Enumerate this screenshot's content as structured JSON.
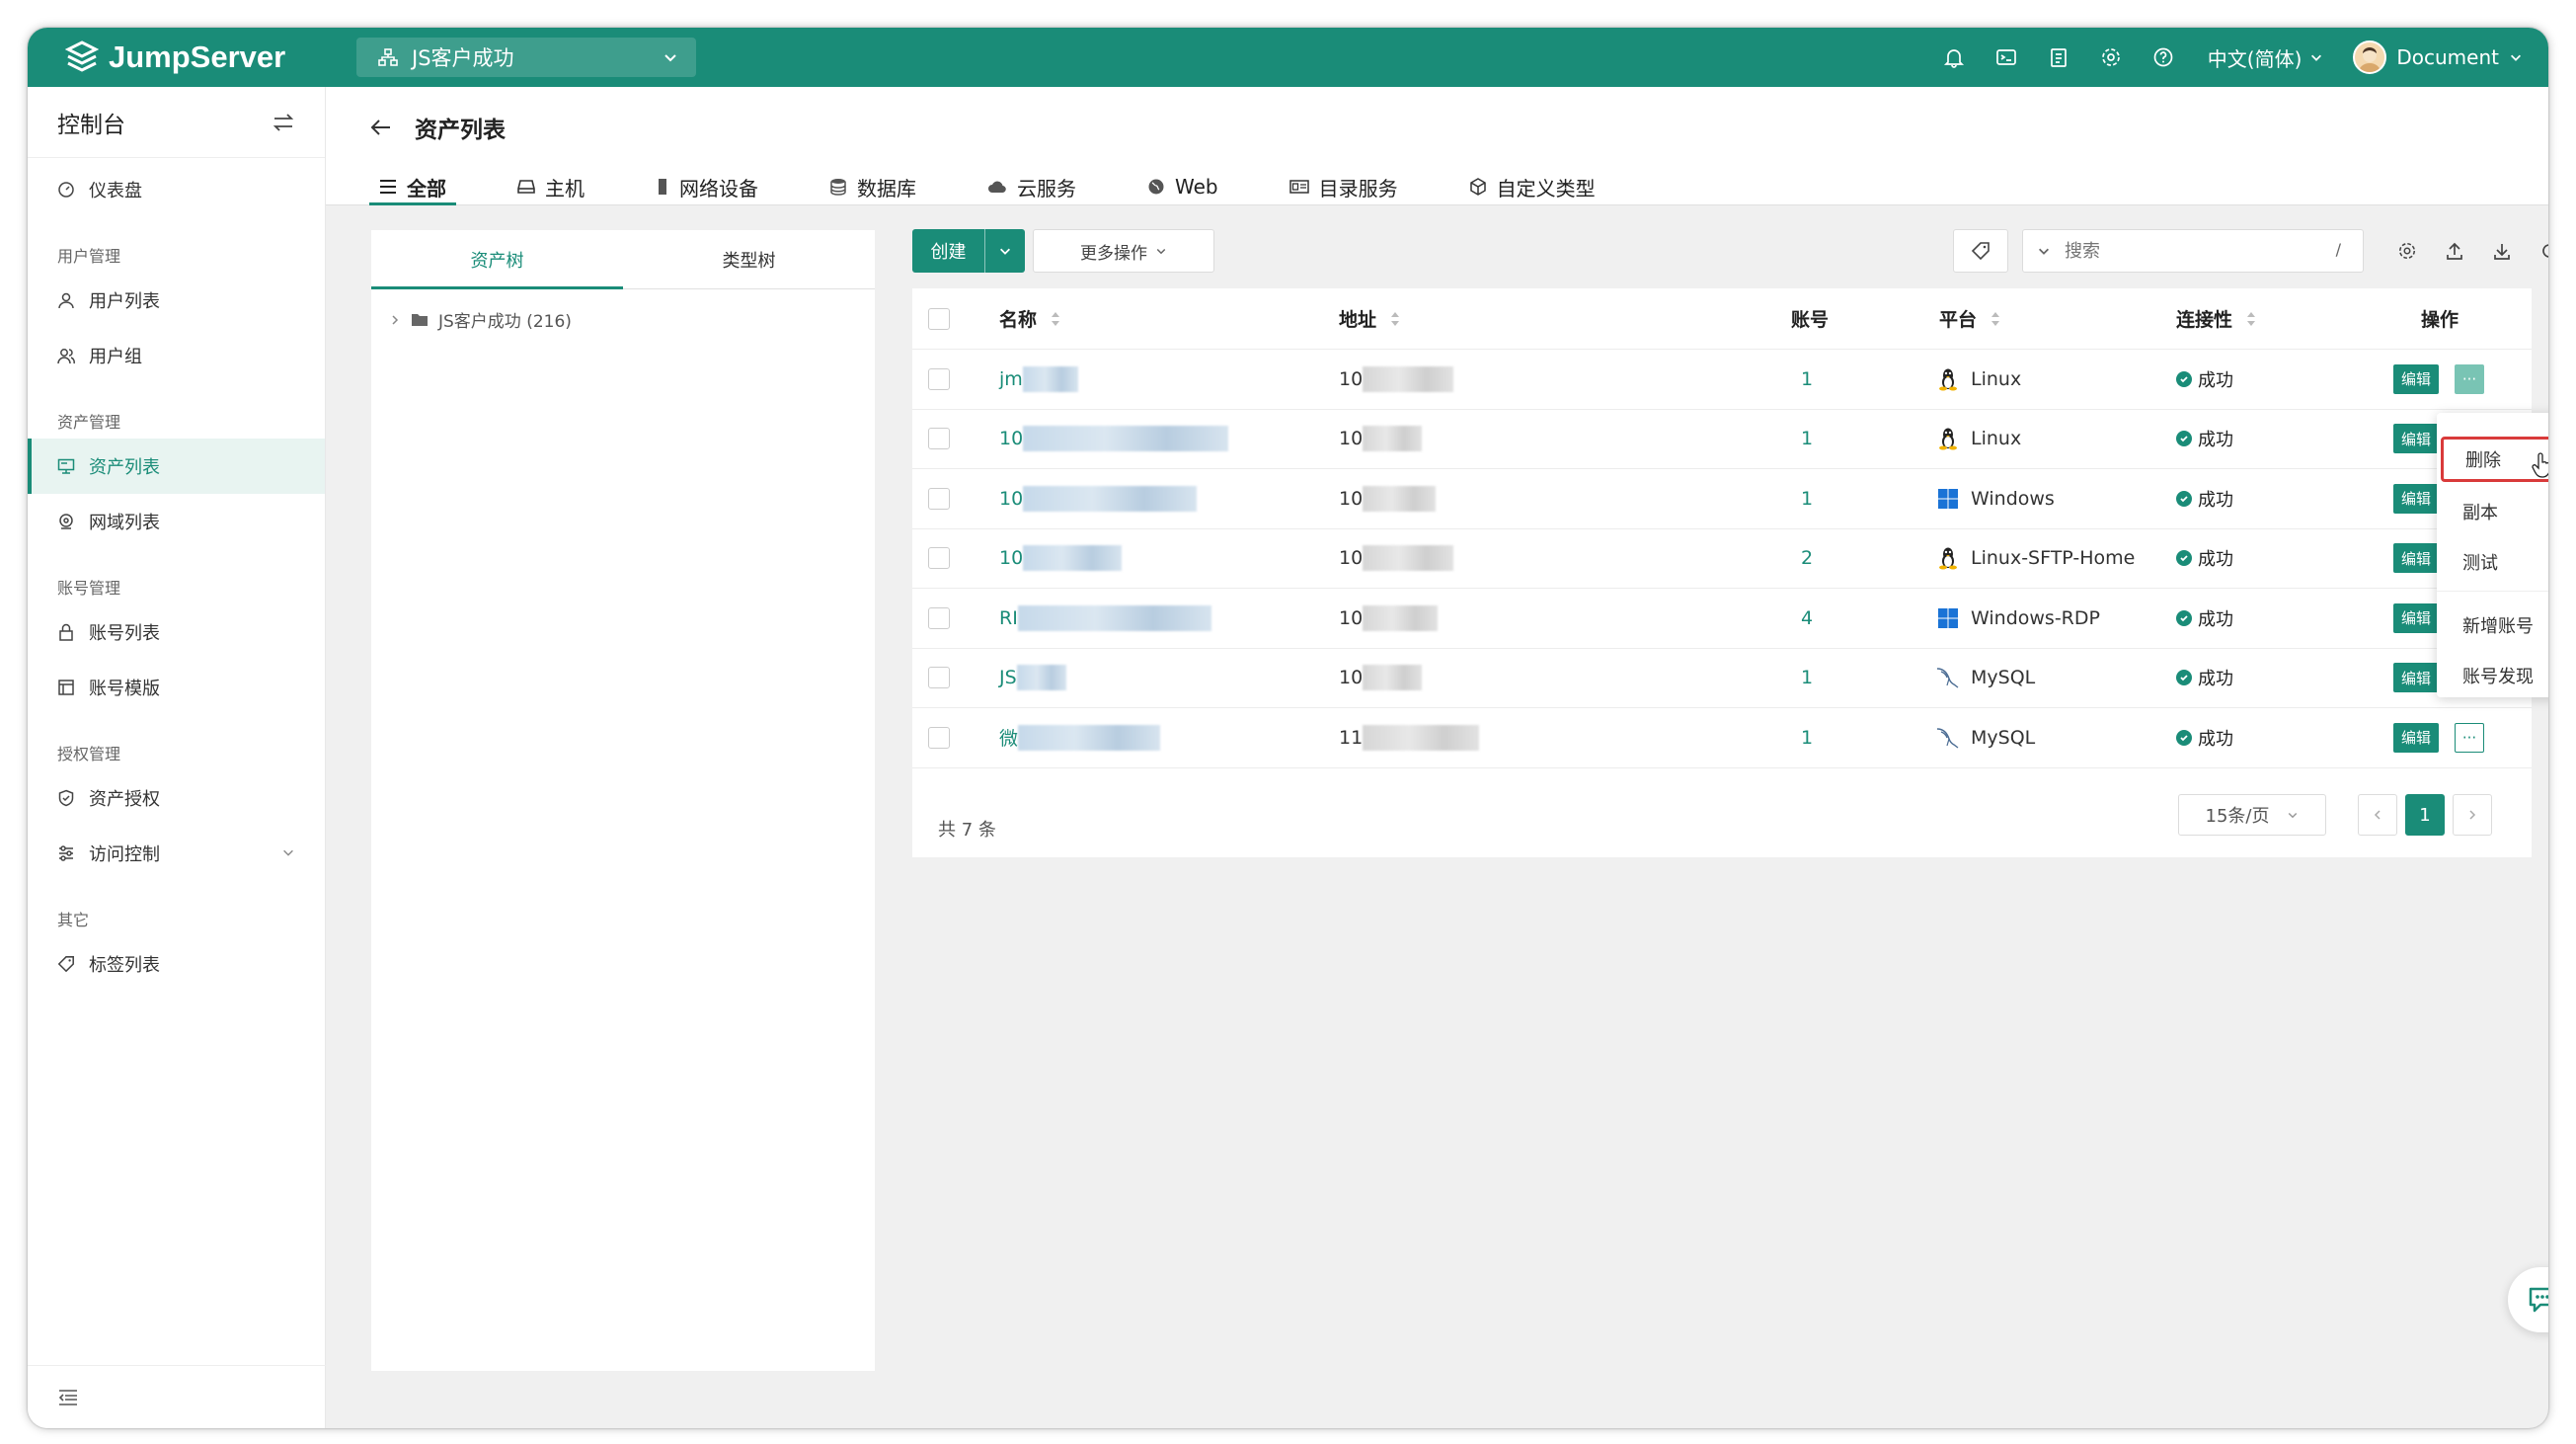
{
  "topbar": {
    "brand": "JumpServer",
    "org": "JS客户成功",
    "language": "中文(简体)",
    "user": "Document",
    "icons": [
      "bell-icon",
      "terminal-icon",
      "clipboard-icon",
      "gear-icon",
      "help-icon"
    ]
  },
  "sidebar": {
    "title": "控制台",
    "items": [
      {
        "type": "item",
        "label": "仪表盘",
        "icon": "dashboard-icon"
      },
      {
        "type": "group",
        "label": "用户管理"
      },
      {
        "type": "item",
        "label": "用户列表",
        "icon": "user-icon"
      },
      {
        "type": "item",
        "label": "用户组",
        "icon": "user-group-icon"
      },
      {
        "type": "group",
        "label": "资产管理"
      },
      {
        "type": "item",
        "label": "资产列表",
        "icon": "monitor-icon",
        "active": true
      },
      {
        "type": "item",
        "label": "网域列表",
        "icon": "location-icon"
      },
      {
        "type": "group",
        "label": "账号管理"
      },
      {
        "type": "item",
        "label": "账号列表",
        "icon": "lock-icon"
      },
      {
        "type": "item",
        "label": "账号模版",
        "icon": "template-icon"
      },
      {
        "type": "group",
        "label": "授权管理"
      },
      {
        "type": "item",
        "label": "资产授权",
        "icon": "shield-icon"
      },
      {
        "type": "item",
        "label": "访问控制",
        "icon": "access-control-icon",
        "expandable": true
      },
      {
        "type": "group",
        "label": "其它"
      },
      {
        "type": "item",
        "label": "标签列表",
        "icon": "tag-icon"
      }
    ]
  },
  "page": {
    "title": "资产列表",
    "tabs": [
      {
        "label": "全部",
        "icon": "list-icon",
        "active": true
      },
      {
        "label": "主机",
        "icon": "host-icon"
      },
      {
        "label": "网络设备",
        "icon": "network-device-icon"
      },
      {
        "label": "数据库",
        "icon": "database-icon"
      },
      {
        "label": "云服务",
        "icon": "cloud-icon"
      },
      {
        "label": "Web",
        "icon": "globe-icon"
      },
      {
        "label": "目录服务",
        "icon": "directory-icon"
      },
      {
        "label": "自定义类型",
        "icon": "cube-icon"
      }
    ]
  },
  "tree": {
    "tabs": [
      "资产树",
      "类型树"
    ],
    "root": "JS客户成功 (216)"
  },
  "toolbar": {
    "create": "创建",
    "more_actions": "更多操作",
    "search_placeholder": "搜索",
    "search_shortcut": "/"
  },
  "table": {
    "headers": {
      "name": "名称",
      "address": "地址",
      "accounts": "账号",
      "platform": "平台",
      "connectivity": "连接性",
      "actions": "操作"
    },
    "rows": [
      {
        "name": "jm",
        "address": "10",
        "accounts": "1",
        "platform": "Linux",
        "os": "linux",
        "status": "成功"
      },
      {
        "name": "10",
        "address": "10",
        "accounts": "1",
        "platform": "Linux",
        "os": "linux",
        "status": "成功"
      },
      {
        "name": "10",
        "address": "10",
        "accounts": "1",
        "platform": "Windows",
        "os": "windows",
        "status": "成功"
      },
      {
        "name": "10",
        "address": "10",
        "accounts": "2",
        "platform": "Linux-SFTP-Home",
        "os": "linux",
        "status": "成功"
      },
      {
        "name": "RI",
        "address": "10",
        "accounts": "4",
        "platform": "Windows-RDP",
        "os": "windows",
        "status": "成功"
      },
      {
        "name": "JS",
        "address": "10",
        "accounts": "1",
        "platform": "MySQL",
        "os": "mysql",
        "status": "成功"
      },
      {
        "name": "微",
        "address": "11",
        "accounts": "1",
        "platform": "MySQL",
        "os": "mysql",
        "status": "成功"
      }
    ],
    "edit_label": "编辑",
    "more_label": "···"
  },
  "pagination": {
    "total": "共 7 条",
    "page_size": "15条/页",
    "current": "1"
  },
  "context_menu": {
    "items": [
      "删除",
      "副本",
      "测试",
      "新增账号",
      "账号发现"
    ]
  },
  "colors": {
    "primary": "#1a8c78",
    "highlight": "#d93a3a"
  }
}
